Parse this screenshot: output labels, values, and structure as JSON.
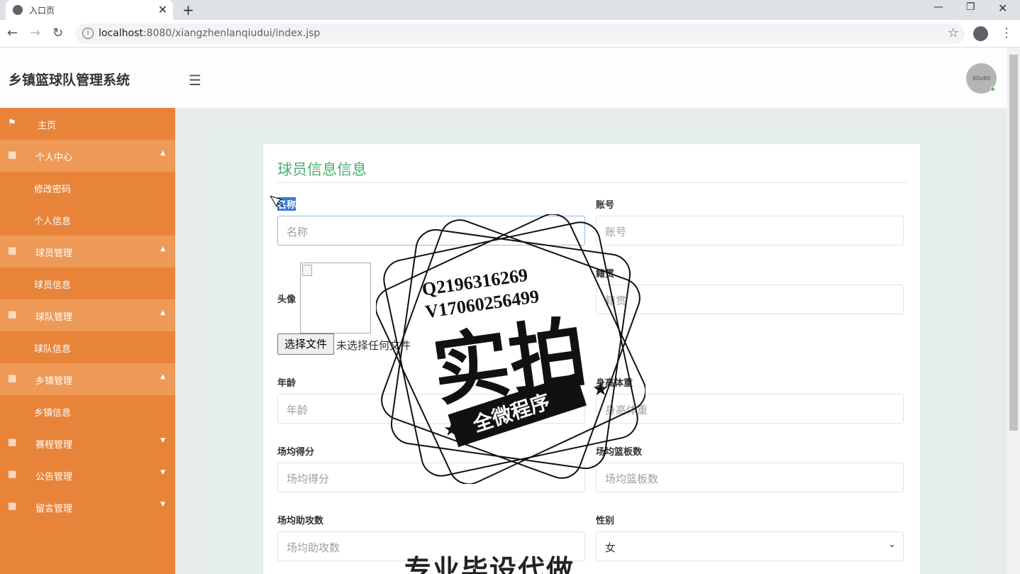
{
  "browser": {
    "tab_title": "入口页",
    "url_host": "localhost",
    "url_path": ":8080/xiangzhenlanqiudui/index.jsp"
  },
  "header": {
    "brand": "乡镇篮球队管理系统",
    "avatar_text": "80x80"
  },
  "sidebar": {
    "home": "主页",
    "personal_center": "个人中心",
    "change_password": "修改密码",
    "personal_info": "个人信息",
    "player_mgmt": "球员管理",
    "player_info": "球员信息",
    "team_mgmt": "球队管理",
    "team_info": "球队信息",
    "town_mgmt": "乡镇管理",
    "town_info": "乡镇信息",
    "schedule_mgmt": "赛程管理",
    "notice_mgmt": "公告管理",
    "message_mgmt": "留言管理"
  },
  "form": {
    "title": "球员信息信息",
    "name_label": "名称",
    "name_placeholder": "名称",
    "account_label": "账号",
    "account_placeholder": "账号",
    "avatar_label": "头像",
    "file_button": "选择文件",
    "file_status": "未选择任何文件",
    "native_label": "籍贯",
    "native_placeholder": "籍贯",
    "age_label": "年龄",
    "age_placeholder": "年龄",
    "height_weight_label": "身高体重",
    "height_weight_placeholder": "身高体重",
    "avg_score_label": "场均得分",
    "avg_score_placeholder": "场均得分",
    "avg_rebound_label": "场均篮板数",
    "avg_rebound_placeholder": "场均篮板数",
    "avg_assist_label": "场均助攻数",
    "avg_assist_placeholder": "场均助攻数",
    "gender_label": "性别",
    "gender_value": "女"
  },
  "watermark": {
    "qq": "Q2196316269",
    "vx": "V17060256499",
    "big": "实拍",
    "banner": "全微程序",
    "bottom": "专业毕设代做"
  }
}
